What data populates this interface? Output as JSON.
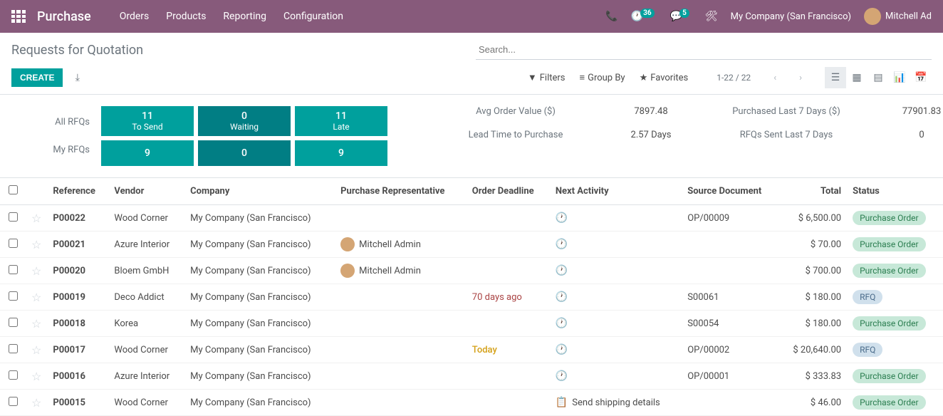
{
  "topbar": {
    "app_title": "Purchase",
    "nav": [
      "Orders",
      "Products",
      "Reporting",
      "Configuration"
    ],
    "badge_clock": "36",
    "badge_chat": "5",
    "company": "My Company (San Francisco)",
    "user": "Mitchell Ad"
  },
  "breadcrumb": "Requests for Quotation",
  "search_placeholder": "Search...",
  "create_label": "CREATE",
  "search_options": {
    "filters": "Filters",
    "groupby": "Group By",
    "favorites": "Favorites"
  },
  "pager": "1-22 / 22",
  "dashboard": {
    "row_labels": [
      "All RFQs",
      "My RFQs"
    ],
    "tiles": [
      {
        "top_num": "11",
        "top_lbl": "To Send",
        "bot_num": "9",
        "dark": false
      },
      {
        "top_num": "0",
        "top_lbl": "Waiting",
        "bot_num": "0",
        "dark": true
      },
      {
        "top_num": "11",
        "top_lbl": "Late",
        "bot_num": "9",
        "dark": false
      }
    ],
    "stats": [
      {
        "lbl": "Avg Order Value ($)",
        "val": "7897.48"
      },
      {
        "lbl": "Purchased Last 7 Days ($)",
        "val": "77901.83"
      },
      {
        "lbl": "Lead Time to Purchase",
        "val": "2.57  Days"
      },
      {
        "lbl": "RFQs Sent Last 7 Days",
        "val": "0"
      }
    ]
  },
  "columns": {
    "reference": "Reference",
    "vendor": "Vendor",
    "company": "Company",
    "rep": "Purchase Representative",
    "deadline": "Order Deadline",
    "activity": "Next Activity",
    "source": "Source Document",
    "total": "Total",
    "status": "Status"
  },
  "rows": [
    {
      "ref": "P00022",
      "vendor": "Wood Corner",
      "company": "My Company (San Francisco)",
      "rep": "",
      "deadline": "",
      "activity_clock": true,
      "activity_text": "",
      "source": "OP/00009",
      "total": "$ 6,500.00",
      "status": "Purchase Order",
      "status_cls": "po"
    },
    {
      "ref": "P00021",
      "vendor": "Azure Interior",
      "company": "My Company (San Francisco)",
      "rep": "Mitchell Admin",
      "deadline": "",
      "activity_clock": true,
      "activity_text": "",
      "source": "",
      "total": "$ 70.00",
      "status": "Purchase Order",
      "status_cls": "po"
    },
    {
      "ref": "P00020",
      "vendor": "Bloem GmbH",
      "company": "My Company (San Francisco)",
      "rep": "Mitchell Admin",
      "deadline": "",
      "activity_clock": true,
      "activity_text": "",
      "source": "",
      "total": "$ 700.00",
      "status": "Purchase Order",
      "status_cls": "po"
    },
    {
      "ref": "P00019",
      "vendor": "Deco Addict",
      "company": "My Company (San Francisco)",
      "rep": "",
      "deadline": "70 days ago",
      "deadline_cls": "overdue",
      "activity_clock": true,
      "activity_text": "",
      "source": "S00061",
      "total": "$ 180.00",
      "status": "RFQ",
      "status_cls": "rfq"
    },
    {
      "ref": "P00018",
      "vendor": "Korea",
      "company": "My Company (San Francisco)",
      "rep": "",
      "deadline": "",
      "activity_clock": true,
      "activity_text": "",
      "source": "S00054",
      "total": "$ 180.00",
      "status": "Purchase Order",
      "status_cls": "po"
    },
    {
      "ref": "P00017",
      "vendor": "Wood Corner",
      "company": "My Company (San Francisco)",
      "rep": "",
      "deadline": "Today",
      "deadline_cls": "today",
      "activity_clock": true,
      "activity_text": "",
      "source": "OP/00002",
      "total": "$ 20,640.00",
      "status": "RFQ",
      "status_cls": "rfq"
    },
    {
      "ref": "P00016",
      "vendor": "Azure Interior",
      "company": "My Company (San Francisco)",
      "rep": "",
      "deadline": "",
      "activity_clock": true,
      "activity_text": "",
      "source": "OP/00001",
      "total": "$ 333.83",
      "status": "Purchase Order",
      "status_cls": "po"
    },
    {
      "ref": "P00015",
      "vendor": "Wood Corner",
      "company": "My Company (San Francisco)",
      "rep": "",
      "deadline": "",
      "activity_clock": false,
      "activity_text": "Send shipping details",
      "source": "",
      "total": "$ 46.00",
      "status": "Purchase Order",
      "status_cls": "po"
    }
  ]
}
